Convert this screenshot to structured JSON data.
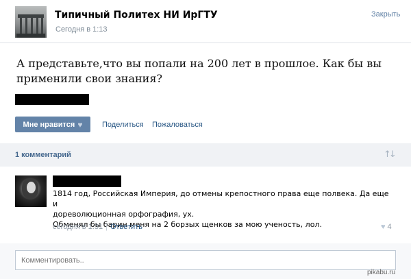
{
  "post": {
    "group_name": "Типичный Политех НИ ИрГТУ",
    "time": "Сегодня в 1:13",
    "close_label": "Закрыть",
    "text": "А представьте,что вы попали на 200 лет в прошлое. Как бы вы применили свои знания?"
  },
  "actions": {
    "like_label": "Мне нравится",
    "share_label": "Поделиться",
    "report_label": "Пожаловаться"
  },
  "comments": {
    "count_label": "1 комментарий",
    "items": [
      {
        "lines": [
          "1814 год, Российская Империя, до отмены крепостного права еще полвека. Да еще и",
          "дореволюционная орфография, ух.",
          "Обменял бы барин меня на 2 борзых щенков за мою ученость, лол."
        ],
        "time": "сегодня в 1:31",
        "reply_label": "Ответить",
        "likes": "4"
      }
    ]
  },
  "compose": {
    "placeholder": "Комментировать.."
  },
  "watermark": "pikabu.ru",
  "colors": {
    "accent": "#6383a8",
    "link": "#2a5885",
    "muted": "#7d8a96",
    "comments_bg": "#f0f2f5"
  },
  "icons": [
    "heart-icon",
    "sort-icon"
  ]
}
